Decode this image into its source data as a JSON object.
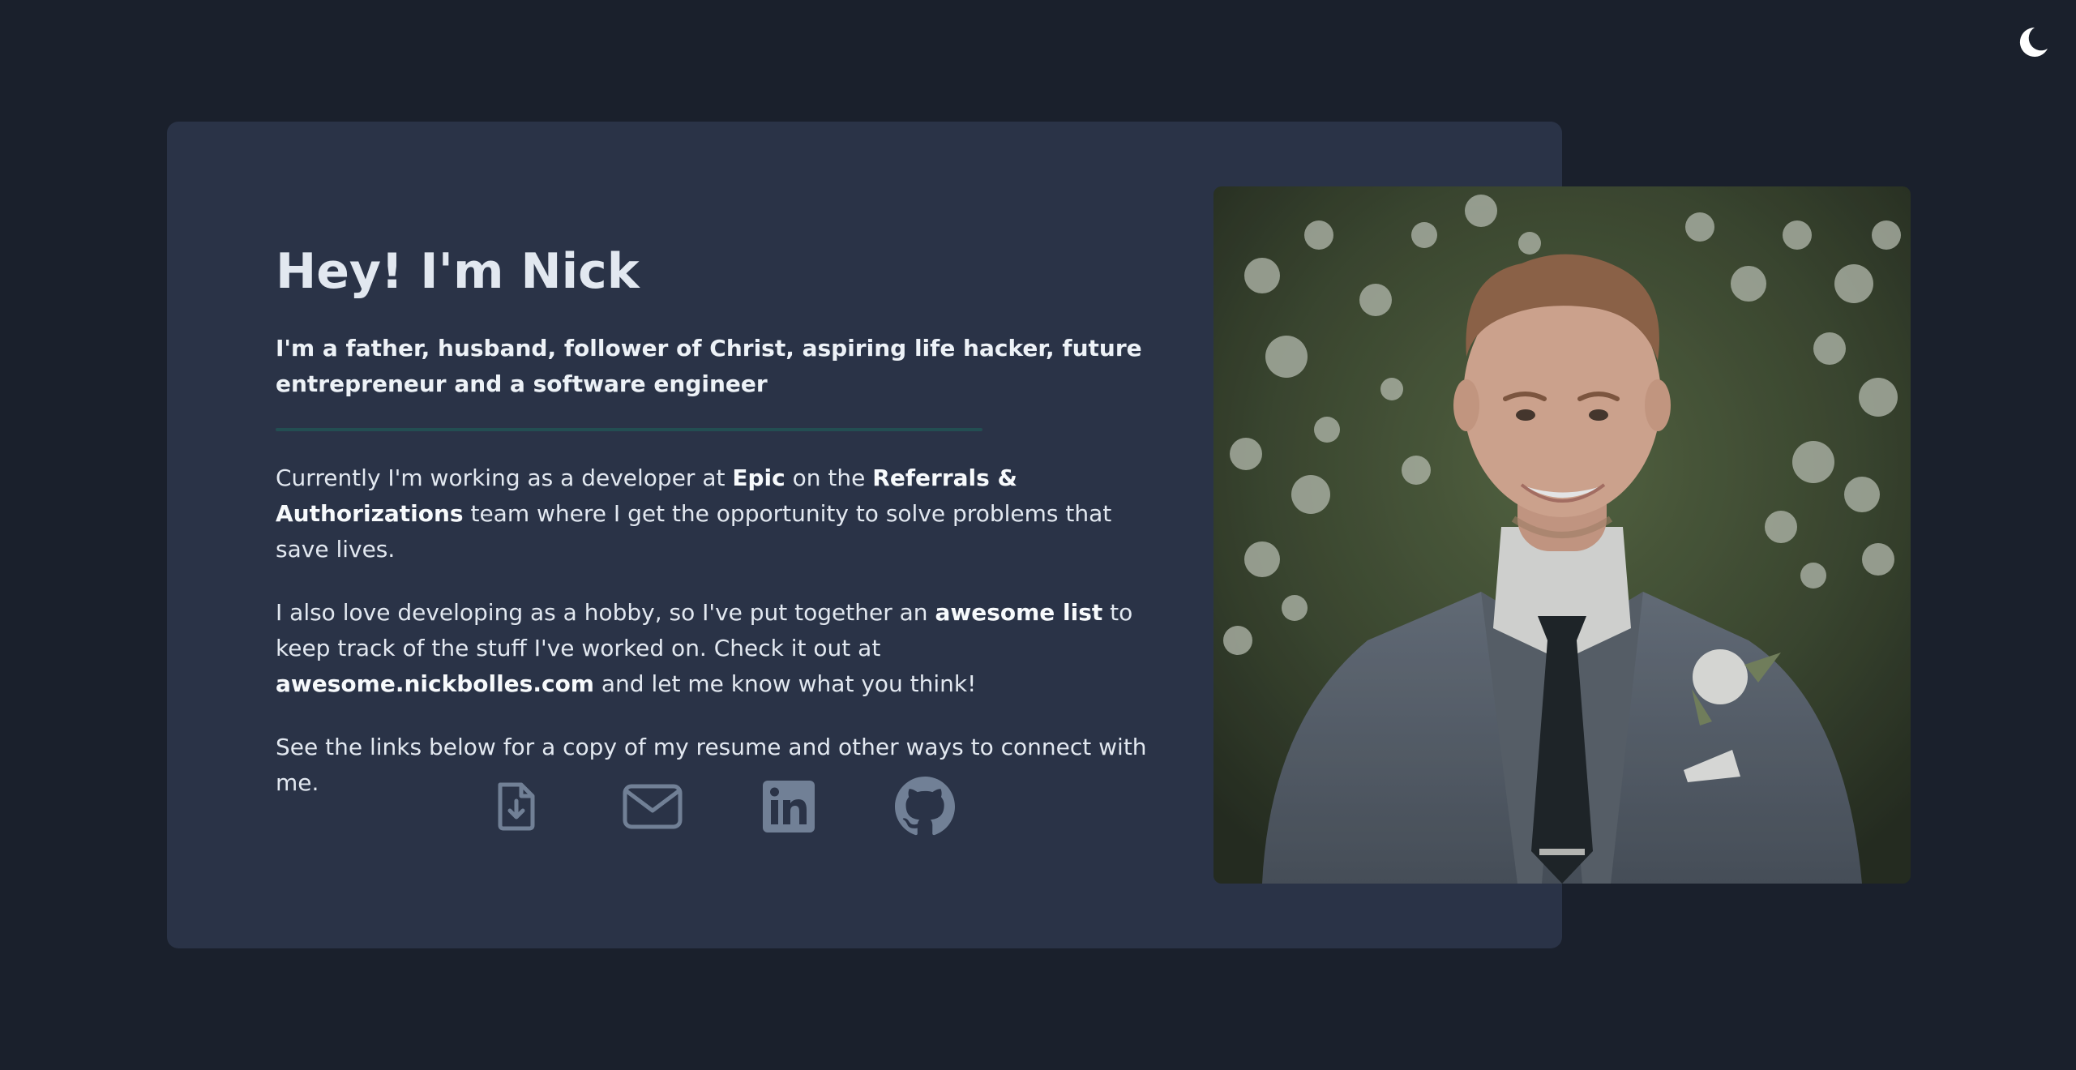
{
  "theme_toggle": {
    "icon": "moon-icon",
    "color": "#ffffff"
  },
  "intro": {
    "title": "Hey! I'm Nick",
    "tagline": "I'm a father, husband, follower of Christ, aspiring life hacker, future entrepreneur and a software engineer",
    "p1": {
      "t1": "Currently I'm working as a developer at ",
      "b1": "Epic",
      "t2": " on the ",
      "b2": "Referrals & Authorizations",
      "t3": " team where I get the opportunity to solve problems that save lives."
    },
    "p2": {
      "t1": "I also love developing as a hobby, so I've put together an ",
      "b1": "awesome list",
      "t2": " to keep track of the stuff I've worked on. Check it out at ",
      "b2": "awesome.nickbolles.com",
      "t3": " and let me know what you think!"
    },
    "p3": "See the links below for a copy of my resume and other ways to connect with me."
  },
  "links": [
    {
      "icon": "resume-download-icon"
    },
    {
      "icon": "email-icon"
    },
    {
      "icon": "linkedin-icon"
    },
    {
      "icon": "github-icon"
    }
  ],
  "colors": {
    "background": "#1a202c",
    "card": "#2a3347",
    "text": "#e2e8f0",
    "divider": "#234e52",
    "icon": "#718096"
  }
}
